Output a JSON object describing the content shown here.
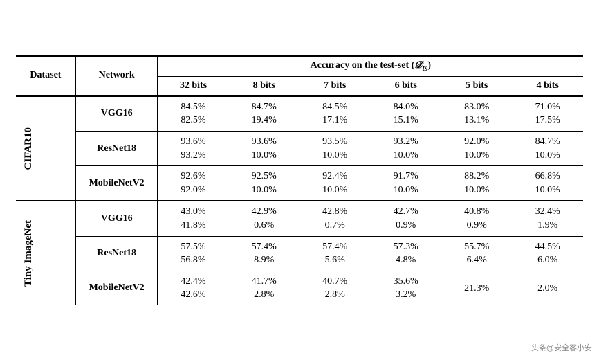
{
  "table": {
    "col_headers": {
      "dataset": "Dataset",
      "network": "Network",
      "accuracy_label": "Accuracy on the test-set",
      "accuracy_math": "(𝒟ts)",
      "bits": [
        "32 bits",
        "8 bits",
        "7 bits",
        "6 bits",
        "5 bits",
        "4 bits"
      ]
    },
    "sections": [
      {
        "dataset": "CIFAR10",
        "rows": [
          {
            "network": "VGG16",
            "values": [
              {
                "l1": "84.5%",
                "l2": "82.5%"
              },
              {
                "l1": "84.7%",
                "l2": "19.4%"
              },
              {
                "l1": "84.5%",
                "l2": "17.1%"
              },
              {
                "l1": "84.0%",
                "l2": "15.1%"
              },
              {
                "l1": "83.0%",
                "l2": "13.1%"
              },
              {
                "l1": "71.0%",
                "l2": "17.5%"
              }
            ]
          },
          {
            "network": "ResNet18",
            "values": [
              {
                "l1": "93.6%",
                "l2": "93.2%"
              },
              {
                "l1": "93.6%",
                "l2": "10.0%"
              },
              {
                "l1": "93.5%",
                "l2": "10.0%"
              },
              {
                "l1": "93.2%",
                "l2": "10.0%"
              },
              {
                "l1": "92.0%",
                "l2": "10.0%"
              },
              {
                "l1": "84.7%",
                "l2": "10.0%"
              }
            ]
          },
          {
            "network": "MobileNetV2",
            "values": [
              {
                "l1": "92.6%",
                "l2": "92.0%"
              },
              {
                "l1": "92.5%",
                "l2": "10.0%"
              },
              {
                "l1": "92.4%",
                "l2": "10.0%"
              },
              {
                "l1": "91.7%",
                "l2": "10.0%"
              },
              {
                "l1": "88.2%",
                "l2": "10.0%"
              },
              {
                "l1": "66.8%",
                "l2": "10.0%"
              }
            ]
          }
        ]
      },
      {
        "dataset": "Tiny ImageNet",
        "rows": [
          {
            "network": "VGG16",
            "values": [
              {
                "l1": "43.0%",
                "l2": "41.8%"
              },
              {
                "l1": "42.9%",
                "l2": "0.6%"
              },
              {
                "l1": "42.8%",
                "l2": "0.7%"
              },
              {
                "l1": "42.7%",
                "l2": "0.9%"
              },
              {
                "l1": "40.8%",
                "l2": "0.9%"
              },
              {
                "l1": "32.4%",
                "l2": "1.9%"
              }
            ]
          },
          {
            "network": "ResNet18",
            "values": [
              {
                "l1": "57.5%",
                "l2": "56.8%"
              },
              {
                "l1": "57.4%",
                "l2": "8.9%"
              },
              {
                "l1": "57.4%",
                "l2": "5.6%"
              },
              {
                "l1": "57.3%",
                "l2": "4.8%"
              },
              {
                "l1": "55.7%",
                "l2": "6.4%"
              },
              {
                "l1": "44.5%",
                "l2": "6.0%"
              }
            ]
          },
          {
            "network": "MobileNetV2",
            "values": [
              {
                "l1": "42.4%",
                "l2": "42.6%"
              },
              {
                "l1": "41.7%",
                "l2": "2.8%"
              },
              {
                "l1": "40.7%",
                "l2": "2.8%"
              },
              {
                "l1": "35.6%",
                "l2": "3.2%"
              },
              {
                "l1": "21.3%",
                "l2": ""
              },
              {
                "l1": "2.0%",
                "l2": ""
              }
            ]
          }
        ]
      }
    ]
  },
  "watermark": "头条@安全客小安"
}
